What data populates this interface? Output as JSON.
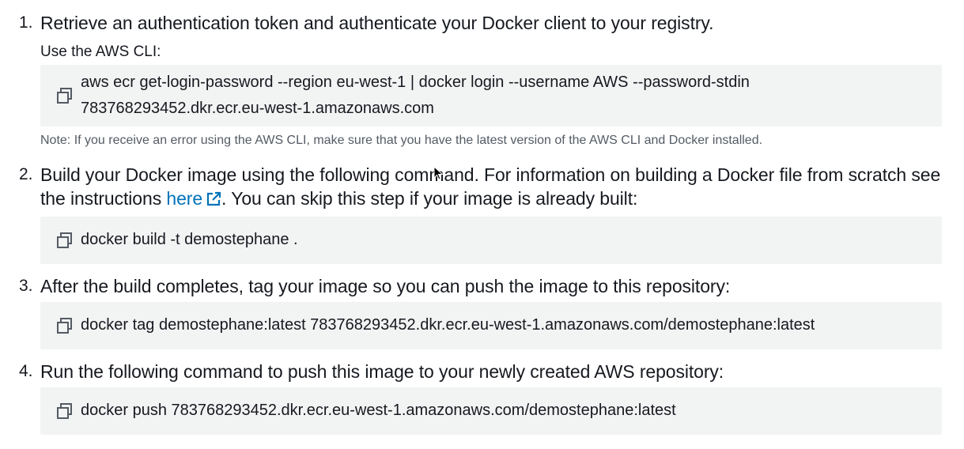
{
  "steps": [
    {
      "number": "1.",
      "text": "Retrieve an authentication token and authenticate your Docker client to your registry.",
      "sublabel": "Use the AWS CLI:",
      "command_line1": "aws ecr get-login-password --region eu-west-1 | docker login --username AWS --password-stdin",
      "command_line2": "783768293452.dkr.ecr.eu-west-1.amazonaws.com",
      "note": "Note: If you receive an error using the AWS CLI, make sure that you have the latest version of the AWS CLI and Docker installed."
    },
    {
      "number": "2.",
      "text_before": "Build your Docker image using the following command. For information on building a Docker file from scratch see the instructions ",
      "link_text": "here",
      "text_after": ". You can skip this step if your image is already built:",
      "command": "docker build -t demostephane ."
    },
    {
      "number": "3.",
      "text": "After the build completes, tag your image so you can push the image to this repository:",
      "command": "docker tag demostephane:latest 783768293452.dkr.ecr.eu-west-1.amazonaws.com/demostephane:latest"
    },
    {
      "number": "4.",
      "text": "Run the following command to push this image to your newly created AWS repository:",
      "command": "docker push 783768293452.dkr.ecr.eu-west-1.amazonaws.com/demostephane:latest"
    }
  ],
  "icons": {
    "copy": "copy-icon",
    "external_link": "external-link-icon"
  },
  "colors": {
    "code_background": "#f2f3f3",
    "link": "#0073bb",
    "text": "#16191f",
    "note": "#545b64"
  }
}
